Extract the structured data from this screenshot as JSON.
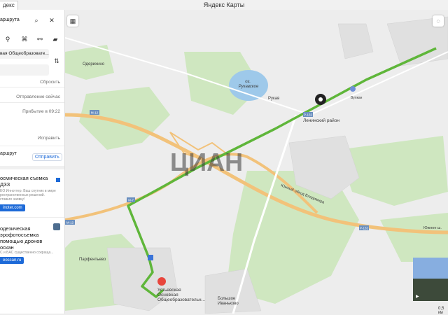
{
  "window": {
    "title": "Яндекс Карты",
    "tab_label": "декс"
  },
  "panel": {
    "route_label": "аршрута",
    "destination": "вая Общеобразовате...",
    "reset_label": "Сбросить",
    "departure_label": "Отправление сейчас",
    "arrival_label": "Прибытие в 09:22",
    "fix_label": "Исправить",
    "share_route_label": "аршрут",
    "send_label": "Отправить",
    "ads": [
      {
        "title": "осмическая съемка\nДЗЗ",
        "body": "ЕО Инноттер. Ваш спутник в мире\nространственных решений.\nставьте заявку!",
        "button": "inoter.com"
      },
      {
        "title": "одезическая\nэрофотосъемка\nпомощью дронов\nоскан",
        "body": "С и БАС существенно сокраща...",
        "button": "eoscan.ru"
      }
    ]
  },
  "map": {
    "lake_name": "оз.\nРукавское",
    "labels": {
      "oderikhino": "Одерихино",
      "rukav": "Рукав",
      "leninsky": "Ленинский район",
      "yuzhny_bypass": "Южный обход Владимира",
      "yuzhnoe": "Южное ш.",
      "parfentyevo": "Парфентьево",
      "destination": "Устьевская\nОсновная\nОбщеобразовательн...",
      "bolshoe_ivankovo": "Большое\nИваньково",
      "stop_label": "Вулкан",
      "watermark": "ЦИАН"
    },
    "road_badges": [
      "М-12",
      "Р-132",
      "М-7",
      "Р-132",
      "М-12"
    ],
    "scale_label": "0,5 км",
    "colors": {
      "route": "#5fb63a",
      "highway": "#f2c27a",
      "water": "#9ec9ea",
      "forest": "#cfe7c0",
      "land": "#ededed"
    }
  }
}
